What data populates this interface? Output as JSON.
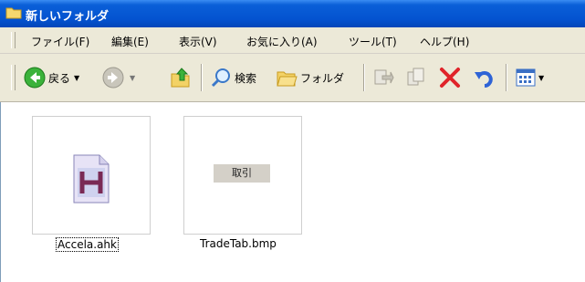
{
  "window": {
    "title": "新しいフォルダ"
  },
  "menu": [
    "ファイル(F)",
    "編集(E)",
    "表示(V)",
    "お気に入り(A)",
    "ツール(T)",
    "ヘルプ(H)"
  ],
  "toolbar": {
    "back_label": "戻る",
    "search_label": "検索",
    "folders_label": "フォルダ"
  },
  "files": [
    {
      "name": "Accela.ahk",
      "icon": "ahk-script-icon"
    },
    {
      "name": "TradeTab.bmp",
      "thumb_text": "取引"
    }
  ],
  "colors": {
    "title_bar": "#0453d0",
    "chrome": "#ece9d8",
    "delete": "#e0242a"
  }
}
